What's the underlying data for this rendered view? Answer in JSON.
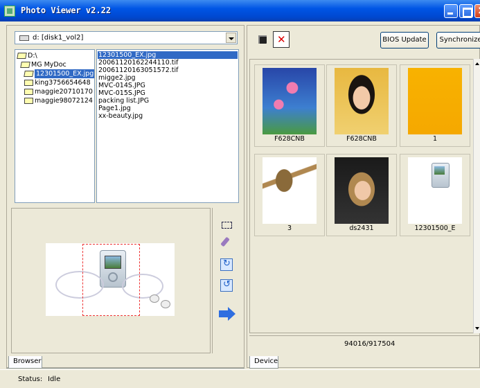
{
  "window": {
    "title": "Photo Viewer v2.22"
  },
  "browser": {
    "drive_select": "d: [disk1_vol2]",
    "folders": [
      "D:\\",
      "MG MyDoc",
      "12301500_EX.jpg",
      "king3756654648",
      "maggie20710170",
      "maggie98072124"
    ],
    "selected_folder": "12301500_EX.jpg",
    "files": [
      "12301500_EX.jpg",
      "20061120162244110.tif",
      "20061120163051572.tif",
      "migge2.jpg",
      "MVC-014S.JPG",
      "MVC-015S.JPG",
      "packing list.JPG",
      "Page1.jpg",
      "xx-beauty.jpg"
    ],
    "selected_file": "12301500_EX.jpg",
    "tab_label": "Browser"
  },
  "toolbar": {
    "bios_update_label": "BIOS Update",
    "synchronize_label": "Synchronize"
  },
  "device": {
    "thumbnails": [
      {
        "caption": "F628CNB",
        "icon": "tulips-photo"
      },
      {
        "caption": "F628CNB",
        "icon": "portrait-photo"
      },
      {
        "caption": "1",
        "icon": "yellow-photo"
      },
      {
        "caption": "3",
        "icon": "sculpture-photo"
      },
      {
        "caption": "ds2431",
        "icon": "woman-photo"
      },
      {
        "caption": "12301500_E",
        "icon": "player-photo"
      }
    ],
    "storage": "94016/917504",
    "tab_label": "Device"
  },
  "status": {
    "label": "Status:",
    "value": "Idle"
  },
  "colors": {
    "title_bar": "#0055e5",
    "selection": "#316ac5",
    "window_bg": "#ece9d8"
  }
}
